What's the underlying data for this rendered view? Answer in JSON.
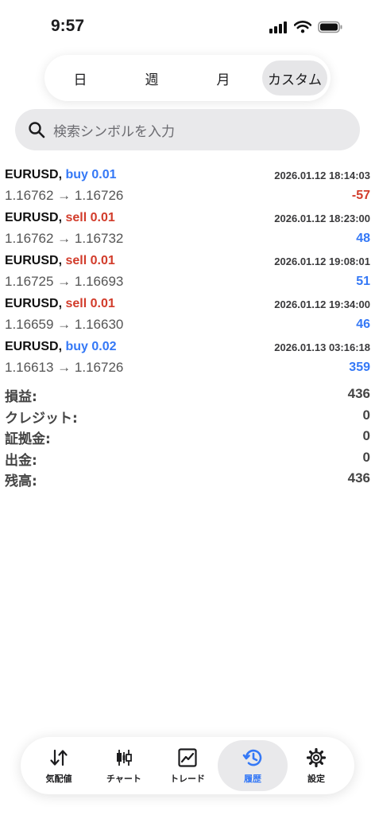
{
  "status_bar": {
    "time": "9:57"
  },
  "period_tabs": [
    {
      "label": "日"
    },
    {
      "label": "週"
    },
    {
      "label": "月"
    },
    {
      "label": "カスタム",
      "active": true
    }
  ],
  "search": {
    "placeholder": "検索シンボルを入力"
  },
  "trades": [
    {
      "symbol": "EURUSD,",
      "side": "buy 0.01",
      "time": "2026.01.12 18:14:03",
      "prices": "1.16762 → 1.16726",
      "profit": "-57"
    },
    {
      "symbol": "EURUSD,",
      "side": "sell 0.01",
      "time": "2026.01.12 18:23:00",
      "prices": "1.16762 → 1.16732",
      "profit": "48"
    },
    {
      "symbol": "EURUSD,",
      "side": "sell 0.01",
      "time": "2026.01.12 19:08:01",
      "prices": "1.16725 → 1.16693",
      "profit": "51"
    },
    {
      "symbol": "EURUSD,",
      "side": "sell 0.01",
      "time": "2026.01.12 19:34:00",
      "prices": "1.16659 → 1.16630",
      "profit": "46"
    },
    {
      "symbol": "EURUSD,",
      "side": "buy 0.02",
      "time": "2026.01.13 03:16:18",
      "prices": "1.16613 → 1.16726",
      "profit": "359"
    }
  ],
  "summary": [
    {
      "label": "損益:",
      "value": "436"
    },
    {
      "label": "クレジット:",
      "value": "0"
    },
    {
      "label": "証拠金:",
      "value": "0"
    },
    {
      "label": "出金:",
      "value": "0"
    },
    {
      "label": "残高:",
      "value": "436"
    }
  ],
  "tab_bar": [
    {
      "label": "気配値",
      "icon": "quotes-arrows-icon"
    },
    {
      "label": "チャート",
      "icon": "candlestick-icon"
    },
    {
      "label": "トレード",
      "icon": "trade-chart-icon"
    },
    {
      "label": "履歴",
      "icon": "history-clock-icon",
      "active": true
    },
    {
      "label": "設定",
      "icon": "gear-icon"
    }
  ],
  "colors": {
    "accent": "#3478f6",
    "loss": "#d23c2b",
    "buy": "#3478f6",
    "sell": "#d23c2b"
  }
}
